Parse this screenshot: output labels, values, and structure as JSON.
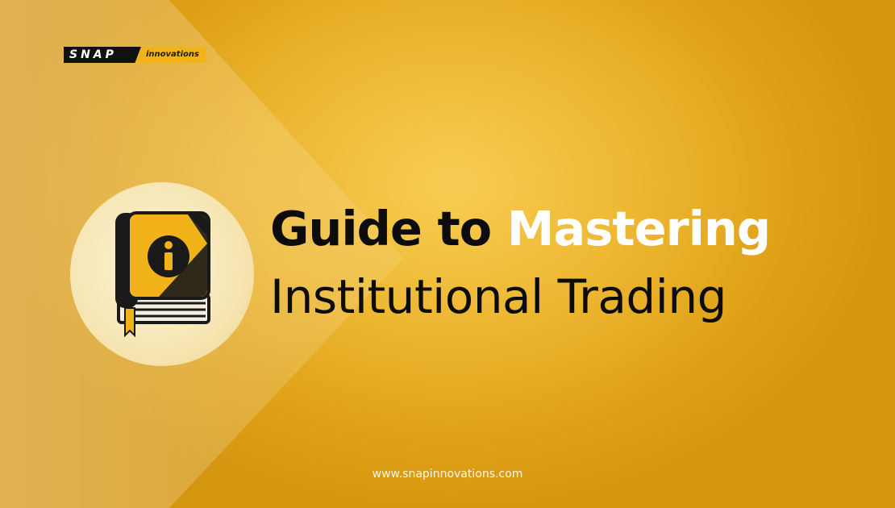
{
  "logo": {
    "primary": "SNAP",
    "secondary": "innovations"
  },
  "headline": {
    "part1": "Guide to",
    "part2": "Mastering"
  },
  "subheadline": "Institutional Trading",
  "footer": {
    "url": "www.snapinnovations.com"
  },
  "icon": {
    "name": "info-book-icon"
  },
  "colors": {
    "background": "#dfa117",
    "book_cover": "#f2b21a",
    "book_dark": "#1a1a1a",
    "headline_dark": "#0c0c0c",
    "headline_light": "#ffffff"
  }
}
